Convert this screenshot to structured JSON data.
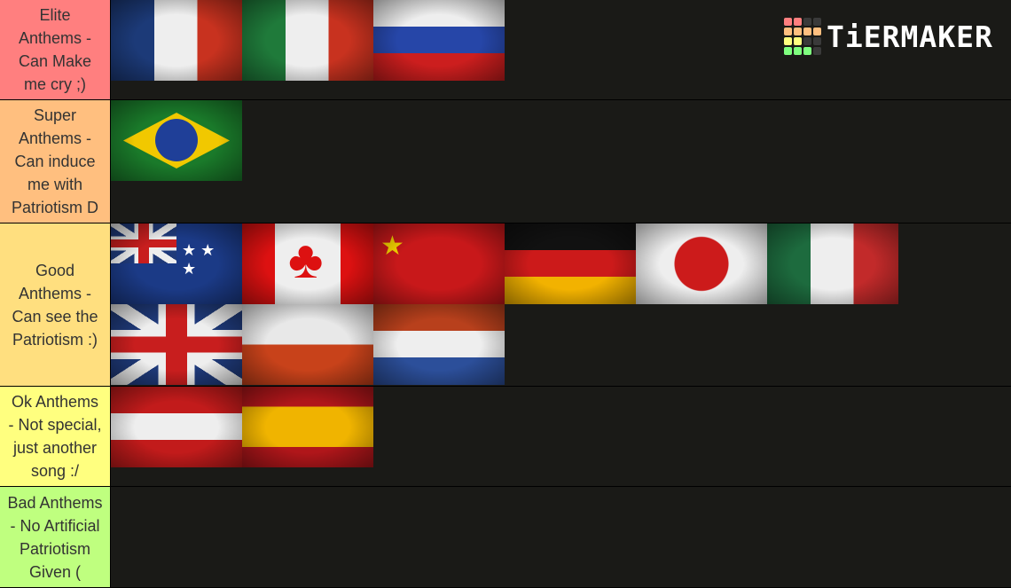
{
  "brand": {
    "text": "TiERMAKER",
    "grid_colors": [
      "#ff7f7f",
      "#ff7f7f",
      "#3a3a3a",
      "#3a3a3a",
      "#ffbf7f",
      "#ffbf7f",
      "#ffbf7f",
      "#ffbf7f",
      "#ffff7f",
      "#ffff7f",
      "#3a3a3a",
      "#3a3a3a",
      "#7fff7f",
      "#7fff7f",
      "#7fff7f",
      "#3a3a3a"
    ]
  },
  "tiers": [
    {
      "label": "Elite\nAnthems -\nCan Make\nme cry  ;)",
      "color": "#ff7f7f",
      "flags": [
        "france",
        "italy",
        "russia"
      ]
    },
    {
      "label": "Super\nAnthems -\nCan induce\nme with\nPatriotism  D",
      "color": "#ffbf7f",
      "flags": [
        "brazil"
      ]
    },
    {
      "label": "Good\nAnthems -\nCan see the\nPatriotism :)",
      "color": "#ffdf7f",
      "flags": [
        "australia",
        "canada",
        "china",
        "germany",
        "japan",
        "mexico",
        "united-kingdom",
        "poland",
        "netherlands"
      ]
    },
    {
      "label": "Ok Anthems\n- Not special,\njust another\nsong  :/",
      "color": "#ffff7f",
      "flags": [
        "austria",
        "spain"
      ]
    },
    {
      "label": "Bad Anthems\n- No Artificial\nPatriotism\nGiven  (",
      "color": "#bfff7f",
      "flags": []
    }
  ]
}
